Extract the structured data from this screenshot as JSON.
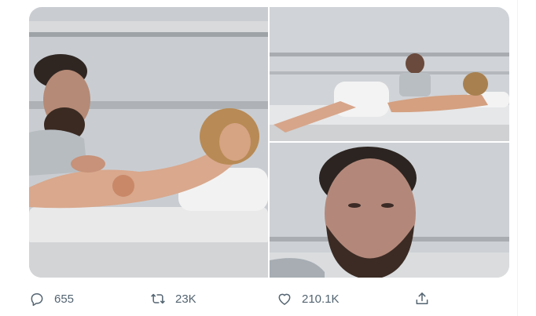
{
  "tweet": {
    "media": [
      {
        "name": "photo-couple-sunbathing-on-yacht"
      },
      {
        "name": "photo-yacht-deck-wide-shot"
      },
      {
        "name": "photo-man-closeup-face"
      }
    ],
    "actions": {
      "reply": {
        "icon": "reply-icon",
        "count": "655"
      },
      "retweet": {
        "icon": "retweet-icon",
        "count": "23K"
      },
      "like": {
        "icon": "heart-icon",
        "count": "210.1K"
      },
      "share": {
        "icon": "share-icon"
      }
    }
  },
  "colors": {
    "action_gray": "#536471",
    "divider": "#eff3f4"
  }
}
